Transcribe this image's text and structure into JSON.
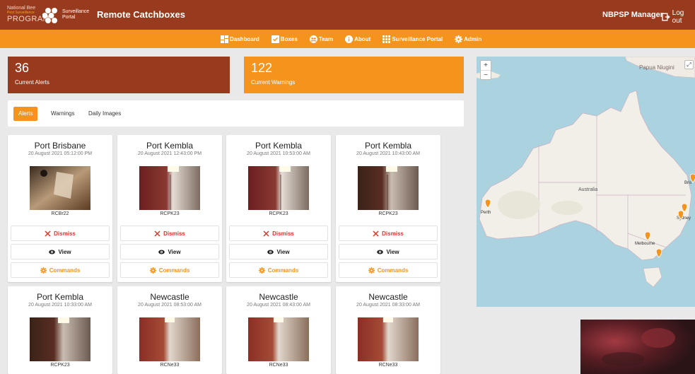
{
  "header": {
    "logo_line1": "National Bee",
    "logo_line2": "Pest Surveillance",
    "logo_line3": "PROGRAM",
    "logo_portal": "Surveillance Portal",
    "app_title": "Remote Catchboxes",
    "user": "NBPSP Manager",
    "logout": "Log out"
  },
  "nav": {
    "items": [
      {
        "label": "Dashboard",
        "icon": "dashboard-icon"
      },
      {
        "label": "Boxes",
        "icon": "check-box-icon"
      },
      {
        "label": "Team",
        "icon": "team-icon"
      },
      {
        "label": "About",
        "icon": "info-icon"
      },
      {
        "label": "Surveillance Portal",
        "icon": "grid-icon"
      },
      {
        "label": "Admin",
        "icon": "gear-icon"
      }
    ]
  },
  "stats": {
    "alerts_count": "36",
    "alerts_label": "Current Alerts",
    "warnings_count": "122",
    "warnings_label": "Current Warnings"
  },
  "tabs": [
    "Alerts",
    "Warnings",
    "Daily Images"
  ],
  "cards": [
    {
      "location": "Port Brisbane",
      "timestamp": "20 August 2021 05:12:00 PM",
      "box": "RCBr22"
    },
    {
      "location": "Port Kembla",
      "timestamp": "20 August 2021 12:43:00 PM",
      "box": "RCPK23"
    },
    {
      "location": "Port Kembla",
      "timestamp": "20 August 2021 10:53:00 AM",
      "box": "RCPK23"
    },
    {
      "location": "Port Kembla",
      "timestamp": "20 August 2021 10:43:00 AM",
      "box": "RCPK23"
    },
    {
      "location": "Port Kembla",
      "timestamp": "20 August 2021 10:33:00 AM",
      "box": "RCPK23"
    },
    {
      "location": "Newcastle",
      "timestamp": "20 August 2021 08:53:00 AM",
      "box": "RCNe33"
    },
    {
      "location": "Newcastle",
      "timestamp": "20 August 2021 08:43:00 AM",
      "box": "RCNe33"
    },
    {
      "location": "Newcastle",
      "timestamp": "20 August 2021 08:33:00 AM",
      "box": "RCNe33"
    }
  ],
  "card_actions": {
    "dismiss": "Dismiss",
    "view": "View",
    "commands": "Commands"
  },
  "map": {
    "labels": {
      "papua": "Papua Niugini",
      "australia": "Australia",
      "perth": "Perth",
      "melbourne": "Melbourne",
      "sydney": "Sydney",
      "brisbane": "Bris"
    },
    "zoom_in": "+",
    "zoom_out": "−"
  },
  "colors": {
    "brand_dark": "#973a1d",
    "brand_orange": "#f5941d",
    "dismiss_red": "#d9372b"
  }
}
